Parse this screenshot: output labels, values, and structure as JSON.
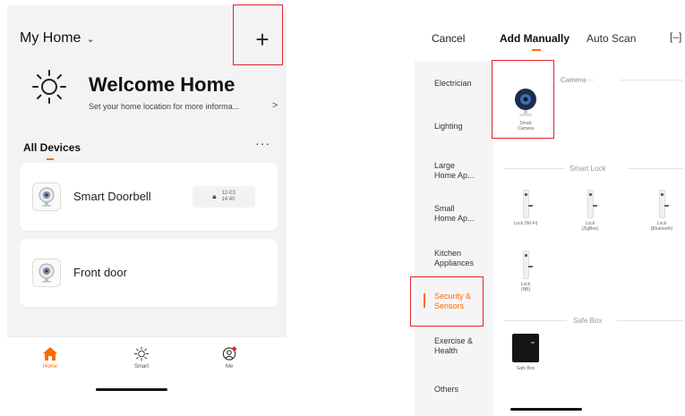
{
  "left_screen": {
    "home_selector": {
      "label": "My Home",
      "chevron": "chevron-down-icon"
    },
    "add_button": {
      "label": "+"
    },
    "welcome": {
      "icon": "sun-icon",
      "title": "Welcome Home",
      "subtitle": "Set your home location for more informa...",
      "arrow": ">"
    },
    "devices_tab": {
      "label": "All Devices",
      "more": "···"
    },
    "devices": [
      {
        "name": "Smart Doorbell",
        "icon": "camera-icon",
        "badge_icon": "lock-icon",
        "badge_text": "12-03\n14:40"
      },
      {
        "name": "Front door",
        "icon": "camera-icon"
      }
    ],
    "bottom_nav": [
      {
        "label": "Home",
        "icon": "home-icon",
        "active": true
      },
      {
        "label": "Smart",
        "icon": "sun-icon",
        "active": false
      },
      {
        "label": "Me",
        "icon": "profile-icon",
        "active": false
      }
    ]
  },
  "right_screen": {
    "top_bar": {
      "cancel": "Cancel",
      "add_manually": "Add Manually",
      "auto_scan": "Auto Scan",
      "expand_icon": "[–]"
    },
    "categories": [
      "Electrician",
      "Lighting",
      "Large Home Ap...",
      "Small Home Ap...",
      "Kitchen Appliances",
      "Security & Sensors",
      "Exercise & Health",
      "Others"
    ],
    "active_category": "Security & Sensors",
    "sections": {
      "camera": {
        "title": "Camera",
        "items": [
          {
            "label": "Smart\nCamera"
          }
        ]
      },
      "smart_lock": {
        "title": "Smart Lock",
        "items": [
          {
            "label": "Lock (Wi-Fi)"
          },
          {
            "label": "Lock\n(ZigBee)"
          },
          {
            "label": "Lock\n(Bluetooth)"
          },
          {
            "label": "Lock\n(NB)"
          }
        ]
      },
      "safe_box": {
        "title": "Safe Box",
        "items": [
          {
            "label": "Safe Box"
          }
        ]
      }
    }
  },
  "colors": {
    "accent": "#ff6a00",
    "highlight_box": "#e0252b"
  }
}
